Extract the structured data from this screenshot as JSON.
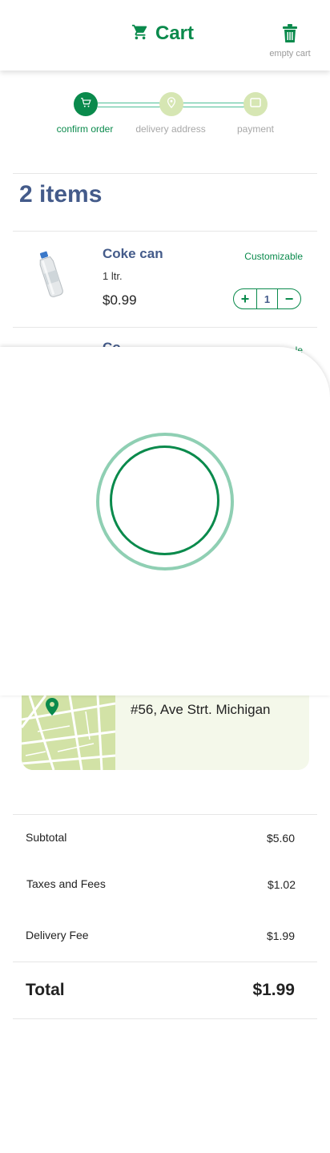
{
  "header": {
    "title": "Cart",
    "cart_icon": "shopping-cart-icon",
    "trash_icon": "trash-icon",
    "empty_label": "empty cart"
  },
  "steps": [
    {
      "label": "confirm order",
      "icon": "cart-icon",
      "status": "active"
    },
    {
      "label": "delivery address",
      "icon": "location-pin-icon",
      "status": "inactive"
    },
    {
      "label": "payment",
      "icon": "card-icon",
      "status": "inactive"
    }
  ],
  "cart": {
    "items_label": "2 items",
    "items": [
      {
        "name": "Coke can",
        "size": "1 ltr.",
        "price": "$0.99",
        "customizable_label": "Customizable",
        "quantity": "1",
        "plus": "+",
        "minus": "−"
      },
      {
        "name": "Co",
        "customizable_label": "le"
      }
    ]
  },
  "address": {
    "text": "#56, Ave Strt. Michigan",
    "pin_icon": "map-pin-icon"
  },
  "summary": {
    "subtotal_label": "Subtotal",
    "subtotal_value": "$5.60",
    "taxes_label": "Taxes and Fees",
    "taxes_value": "$1.02",
    "delivery_label": "Delivery Fee",
    "delivery_value": "$1.99",
    "total_label": "Total",
    "total_value": "$1.99"
  },
  "colors": {
    "brand_green": "#0a8a4c",
    "light_green": "#d6e6b3",
    "heading_blue": "#445b8a"
  }
}
